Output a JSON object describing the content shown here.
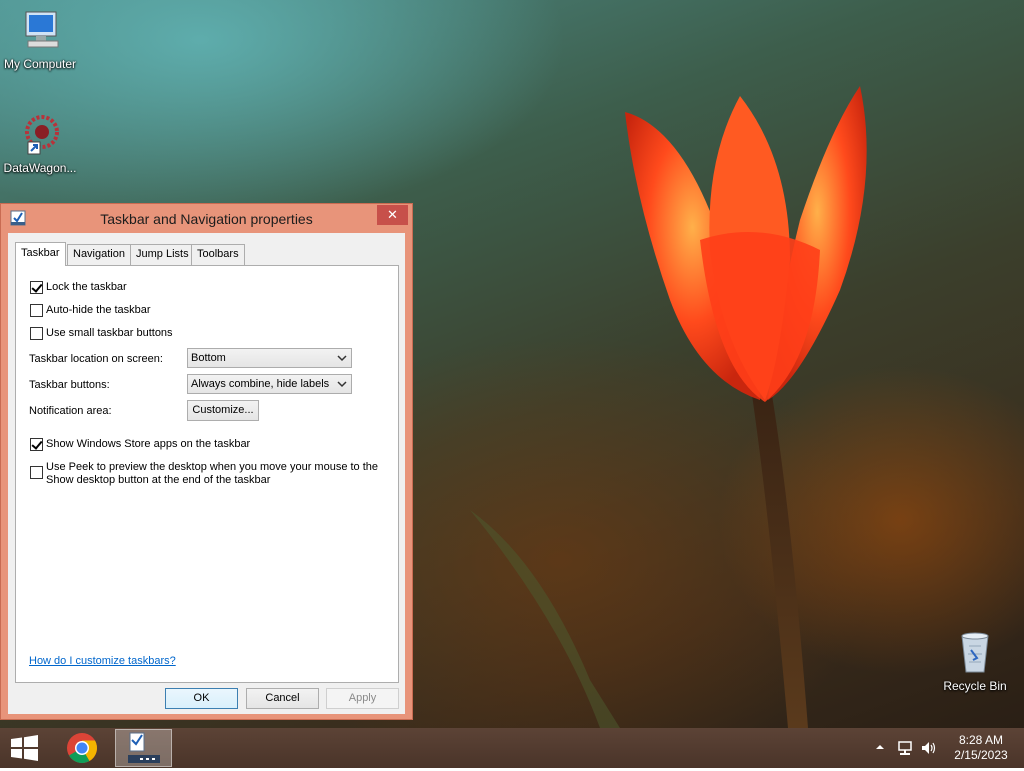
{
  "desktop": {
    "icons": [
      {
        "label": "My Computer",
        "icon": "computer-icon"
      },
      {
        "label": "DataWagon...",
        "icon": "datawagon-shortcut-icon"
      },
      {
        "label": "Recycle Bin",
        "icon": "recycle-bin-icon"
      }
    ]
  },
  "window": {
    "title": "Taskbar and Navigation properties",
    "close_symbol": "✕",
    "tabs": [
      {
        "label": "Taskbar",
        "active": true
      },
      {
        "label": "Navigation",
        "active": false
      },
      {
        "label": "Jump Lists",
        "active": false
      },
      {
        "label": "Toolbars",
        "active": false
      }
    ],
    "options": {
      "lock_taskbar": {
        "label": "Lock the taskbar",
        "checked": true
      },
      "auto_hide": {
        "label": "Auto-hide the taskbar",
        "checked": false
      },
      "small_buttons": {
        "label": "Use small taskbar buttons",
        "checked": false
      },
      "location": {
        "label": "Taskbar location on screen:",
        "value": "Bottom"
      },
      "buttons": {
        "label": "Taskbar buttons:",
        "value": "Always combine, hide labels"
      },
      "notification": {
        "label": "Notification area:",
        "button": "Customize..."
      },
      "store_apps": {
        "label": "Show Windows Store apps on the taskbar",
        "checked": true
      },
      "peek": {
        "label": "Use Peek to preview the desktop when you move your mouse to the Show desktop button at the end of the taskbar",
        "checked": false
      }
    },
    "help_link": "How do I customize taskbars?",
    "buttons": {
      "ok": "OK",
      "cancel": "Cancel",
      "apply": "Apply"
    }
  },
  "taskbar": {
    "pinned": [
      "windows-start-icon",
      "chrome-icon",
      "taskbar-properties-icon"
    ],
    "tray_icons": [
      "show-hidden-icons-chevron",
      "network-icon",
      "volume-icon"
    ],
    "clock": {
      "time": "8:28 AM",
      "date": "2/15/2023"
    }
  },
  "colors": {
    "window_frame": "#e8947a",
    "close_button": "#c7504a",
    "taskbar": "#4a3429",
    "link": "#0066cc"
  }
}
